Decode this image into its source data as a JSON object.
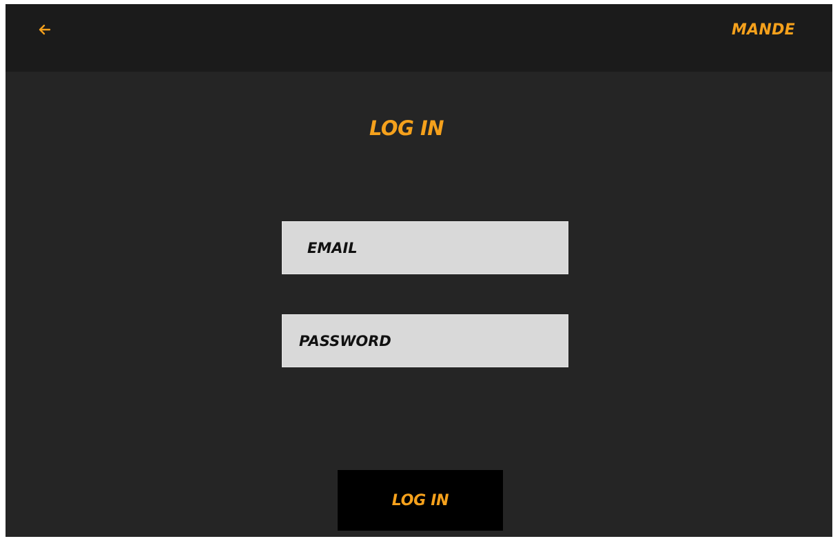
{
  "header": {
    "back_icon": "arrow-left-icon",
    "brand": "MANDE"
  },
  "main": {
    "title": "LOG IN",
    "email_placeholder": "EMAIL",
    "password_placeholder": "PASSWORD",
    "submit_label": "LOG IN"
  },
  "colors": {
    "accent": "#f5a11c",
    "background": "#252525",
    "header_background": "#1b1b1b",
    "field_background": "#d9d9d9",
    "button_background": "#000000"
  }
}
